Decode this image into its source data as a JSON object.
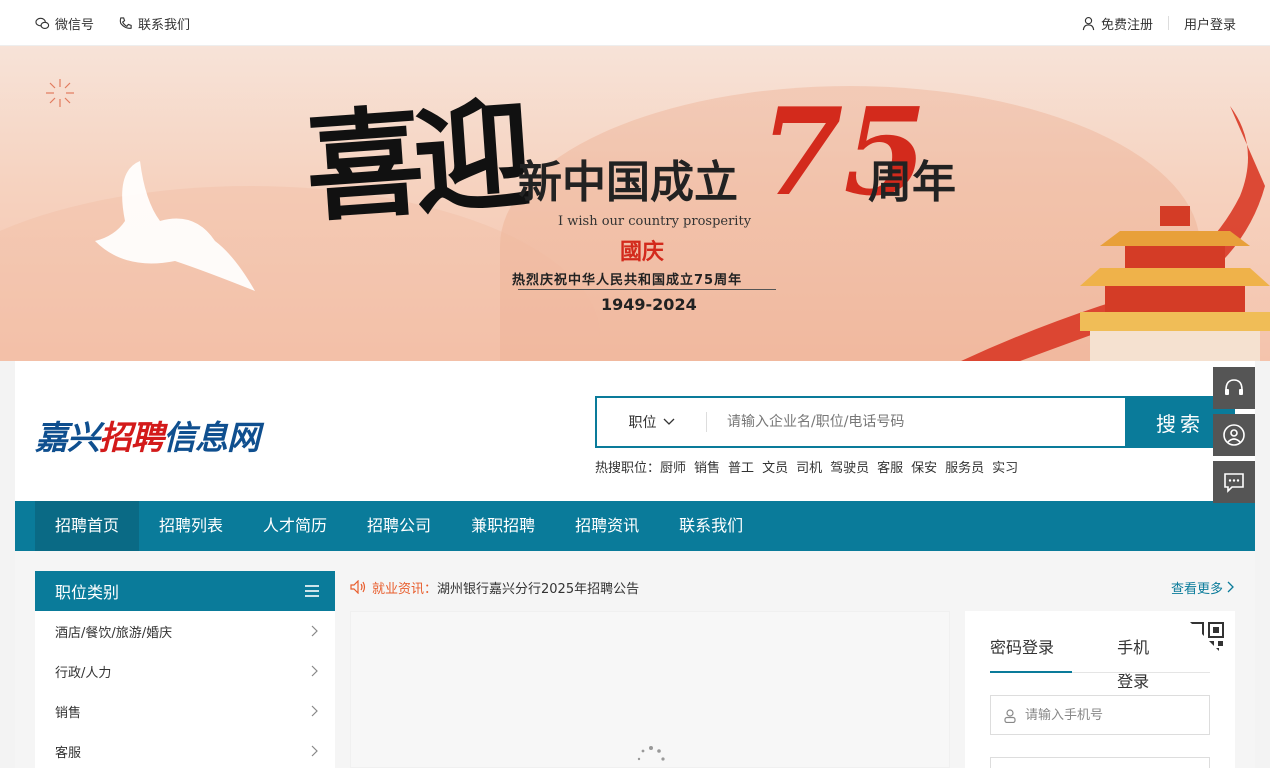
{
  "topbar": {
    "wechat": "微信号",
    "contact": "联系我们",
    "register": "免费注册",
    "login": "用户登录"
  },
  "banner": {
    "headline_big": "喜迎",
    "headline_mid": "新中国成立",
    "number": "75",
    "headline_end": "周年",
    "english": "I wish our country prosperity",
    "guoqing": "國庆",
    "celebrate": "热烈庆祝中华人民共和国成立75周年",
    "years": "1949-2024"
  },
  "logo": {
    "part1": "嘉兴",
    "part2": "招聘",
    "part3": "信息网"
  },
  "search": {
    "type_label": "职位",
    "placeholder": "请输入企业名/职位/电话号码",
    "button": "搜索"
  },
  "hot": {
    "label": "热搜职位：",
    "items": [
      "厨师",
      "销售",
      "普工",
      "文员",
      "司机",
      "驾驶员",
      "客服",
      "保安",
      "服务员",
      "实习"
    ]
  },
  "nav": {
    "items": [
      "招聘首页",
      "招聘列表",
      "人才简历",
      "招聘公司",
      "兼职招聘",
      "招聘资讯",
      "联系我们"
    ]
  },
  "category": {
    "title": "职位类别",
    "items": [
      "酒店/餐饮/旅游/婚庆",
      "行政/人力",
      "销售",
      "客服"
    ]
  },
  "news": {
    "label": "就业资讯：",
    "headline": "湖州银行嘉兴分行2025年招聘公告",
    "more": "查看更多"
  },
  "login": {
    "tab_password": "密码登录",
    "tab_phone": "手机登录",
    "phone_placeholder": "请输入手机号"
  },
  "colors": {
    "primary": "#0a7b9a",
    "accent": "#e85d2c",
    "logo_blue": "#0f4f8f",
    "logo_red": "#d31a1a"
  }
}
